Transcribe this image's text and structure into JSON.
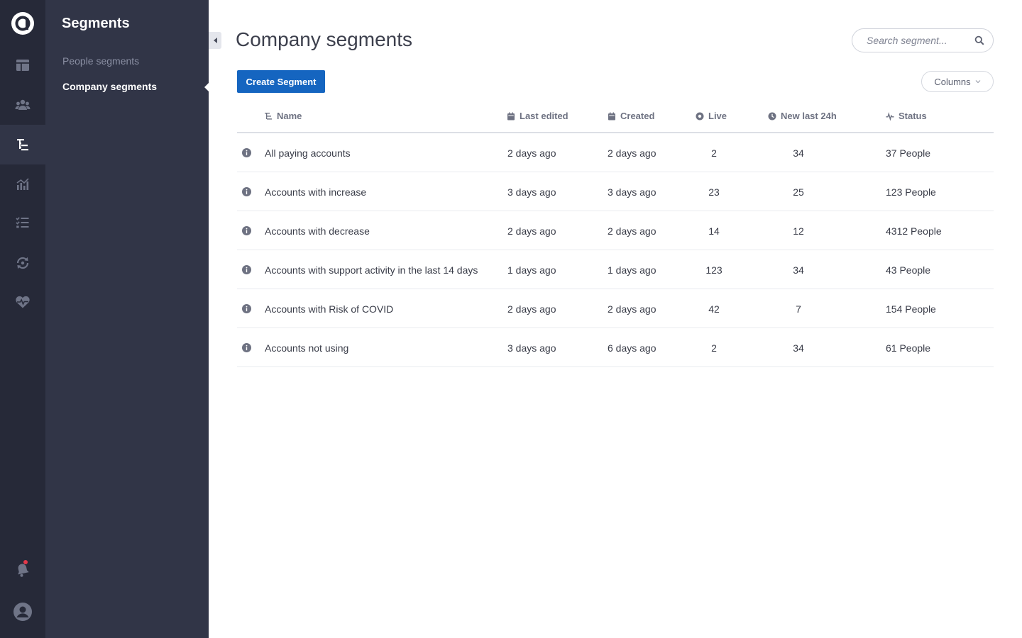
{
  "rail": {
    "items": [
      {
        "icon": "dashboard-icon",
        "active": false
      },
      {
        "icon": "people-icon",
        "active": false
      },
      {
        "icon": "segments-icon",
        "active": true
      },
      {
        "icon": "analytics-icon",
        "active": false
      },
      {
        "icon": "checklist-icon",
        "active": false
      },
      {
        "icon": "sync-icon",
        "active": false
      },
      {
        "icon": "health-icon",
        "active": false
      }
    ],
    "bottom": [
      {
        "icon": "notifications-icon"
      },
      {
        "icon": "avatar-icon"
      }
    ]
  },
  "sidebar": {
    "title": "Segments",
    "items": [
      {
        "label": "People segments",
        "active": false
      },
      {
        "label": "Company segments",
        "active": true
      }
    ]
  },
  "header": {
    "title": "Company segments",
    "search_placeholder": "Search segment..."
  },
  "toolbar": {
    "create_label": "Create Segment",
    "columns_label": "Columns"
  },
  "table": {
    "columns": [
      {
        "label": "Name",
        "icon": "name-sort-icon"
      },
      {
        "label": "Last edited",
        "icon": "calendar-icon"
      },
      {
        "label": "Created",
        "icon": "calendar-icon"
      },
      {
        "label": "Live",
        "icon": "live-icon"
      },
      {
        "label": "New last 24h",
        "icon": "clock-icon"
      },
      {
        "label": "Status",
        "icon": "pulse-icon"
      }
    ],
    "rows": [
      {
        "name": "All paying accounts",
        "last_edited": "2 days ago",
        "created": "2 days ago",
        "live": "2",
        "new_last_24h": "34",
        "status": "37 People"
      },
      {
        "name": "Accounts with increase",
        "last_edited": "3 days ago",
        "created": "3 days ago",
        "live": "23",
        "new_last_24h": "25",
        "status": "123 People"
      },
      {
        "name": "Accounts with decrease",
        "last_edited": "2 days ago",
        "created": "2 days ago",
        "live": "14",
        "new_last_24h": "12",
        "status": "4312 People"
      },
      {
        "name": "Accounts with support activity in the last 14 days",
        "last_edited": "1 days ago",
        "created": "1 days ago",
        "live": "123",
        "new_last_24h": "34",
        "status": "43 People"
      },
      {
        "name": "Accounts with Risk of COVID",
        "last_edited": "2 days ago",
        "created": "2 days ago",
        "live": "42",
        "new_last_24h": "7",
        "status": "154 People"
      },
      {
        "name": "Accounts not using",
        "last_edited": "3 days ago",
        "created": "6 days ago",
        "live": "2",
        "new_last_24h": "34",
        "status": "61 People"
      }
    ]
  },
  "colors": {
    "rail_bg": "#262938",
    "sidebar_bg": "#313547",
    "primary": "#1565c0",
    "notification_dot": "#e5394b"
  }
}
